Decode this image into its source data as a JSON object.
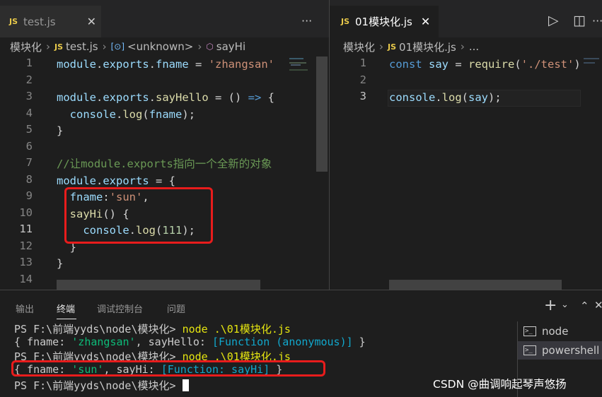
{
  "left_editor": {
    "tab": {
      "badge": "JS",
      "label": "test.js",
      "close": "✕"
    },
    "more": "···",
    "breadcrumb": [
      "模块化",
      "test.js",
      "<unknown>",
      "sayHi"
    ],
    "breadcrumb_icons": {
      "file": "JS",
      "object": "[⊙]",
      "method": "⬡"
    },
    "line_numbers": [
      "1",
      "2",
      "3",
      "4",
      "5",
      "6",
      "7",
      "8",
      "9",
      "10",
      "11",
      "12",
      "13",
      "14"
    ]
  },
  "right_editor": {
    "tab": {
      "badge": "JS",
      "label": "01模块化.js",
      "close": "✕"
    },
    "actions": {
      "run": "▷",
      "split": "◫",
      "more": "···"
    },
    "breadcrumb": [
      "模块化",
      "01模块化.js",
      "..."
    ],
    "line_numbers": [
      "1",
      "2",
      "3"
    ]
  },
  "panel": {
    "tabs": [
      "输出",
      "终端",
      "调试控制台",
      "问题"
    ],
    "active_tab": "终端",
    "actions": {
      "add": "+",
      "dropdown": "⌄",
      "maximize": "⌃",
      "close": "✕"
    },
    "terminals": [
      "node",
      "powershell"
    ],
    "selected_terminal": "powershell",
    "prompt": "PS F:\\前端yyds\\node\\模块化>",
    "command": "node .\\01模块化.js"
  },
  "watermark": "CSDN @曲调响起琴声悠扬",
  "colors": {
    "highlight_box": "#e81c1c",
    "editor_bg": "#1e1e1e",
    "tab_bar_bg": "#252526"
  }
}
